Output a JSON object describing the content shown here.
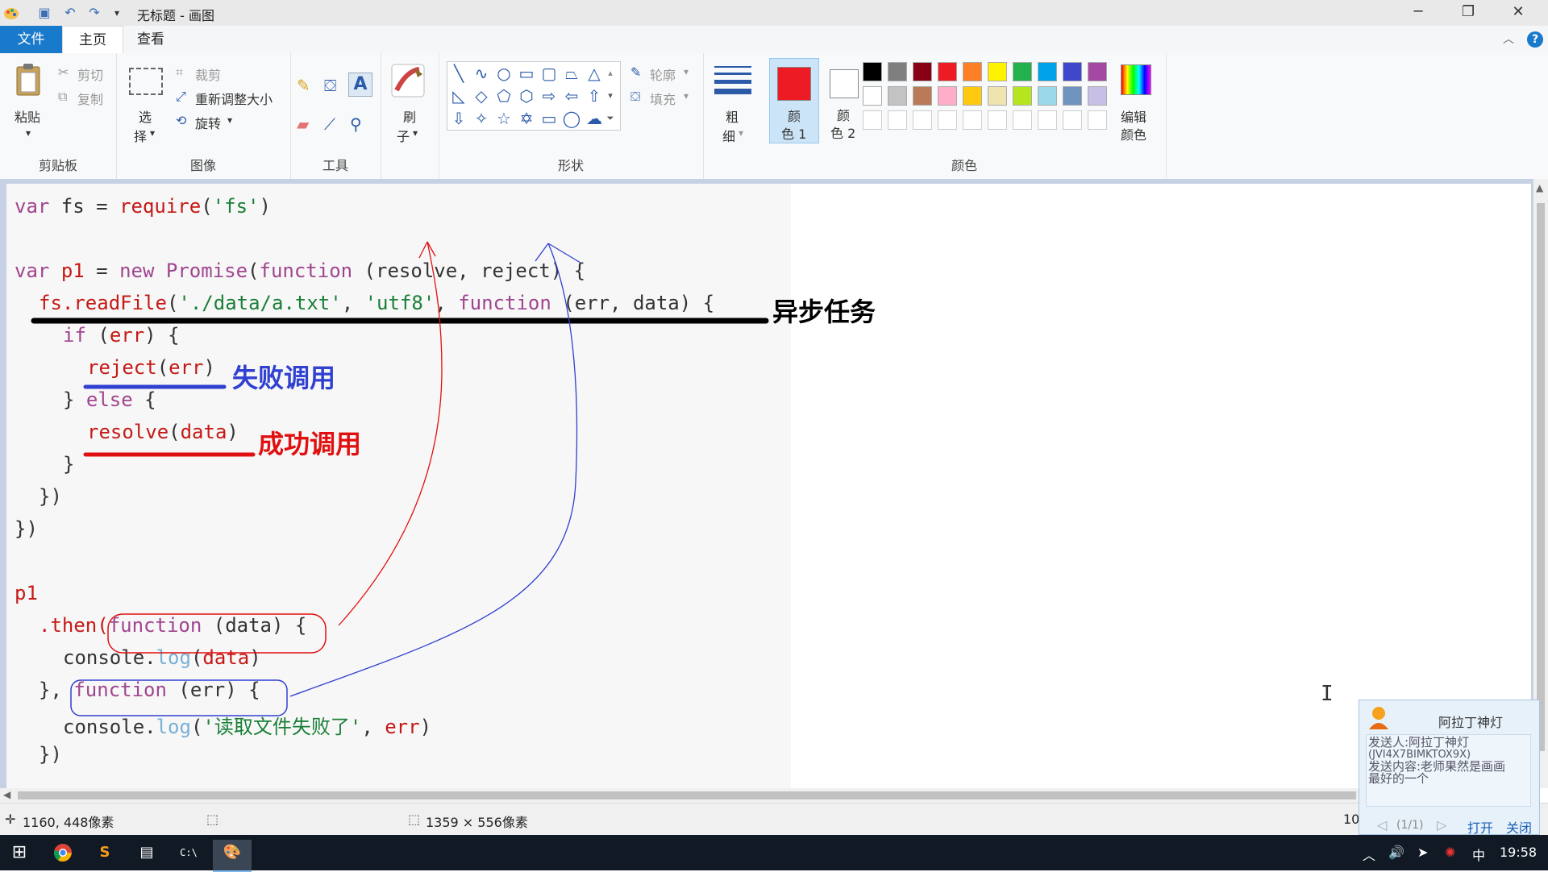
{
  "window": {
    "title": "无标题 - 画图"
  },
  "tabs": [
    "文件",
    "主页",
    "查看"
  ],
  "ribbon": {
    "clipboard": {
      "paste": "粘贴",
      "cut": "剪切",
      "copy": "复制",
      "label": "剪贴板"
    },
    "image": {
      "select_line1": "选",
      "select_line2": "择",
      "crop": "裁剪",
      "resize": "重新调整大小",
      "rotate": "旋转",
      "label": "图像"
    },
    "tools": {
      "label": "工具"
    },
    "brush": {
      "line1": "刷",
      "line2": "子"
    },
    "shapes": {
      "outline": "轮廓",
      "fill": "填充",
      "label": "形状"
    },
    "size": {
      "line1": "粗",
      "line2": "细"
    },
    "color1": {
      "line1": "颜",
      "line2": "色 1",
      "value": "#ed1c24"
    },
    "color2": {
      "line1": "颜",
      "line2": "色 2",
      "value": "#ffffff"
    },
    "colors": {
      "label": "颜色",
      "row1": [
        "#000000",
        "#7f7f7f",
        "#880015",
        "#ed1c24",
        "#ff7f27",
        "#fff200",
        "#22b14c",
        "#00a2e8",
        "#3f48cc",
        "#a349a4"
      ],
      "row2": [
        "#ffffff",
        "#c3c3c3",
        "#b97a57",
        "#ffaec9",
        "#ffc90e",
        "#efe4b0",
        "#b5e61d",
        "#99d9ea",
        "#7092be",
        "#c8bfe7"
      ]
    },
    "edit_colors": {
      "line1": "编辑",
      "line2": "颜色"
    }
  },
  "code": {
    "line1": {
      "a": "var",
      "b": " fs = ",
      "c": "require",
      "d": "(",
      "e": "'fs'",
      "f": ")"
    },
    "line3": {
      "a": "var",
      "b": " ",
      "c": "p1",
      "d": " = ",
      "e": "new",
      "f": " ",
      "g": "Promise",
      "h": "(",
      "i": "function",
      "j": " (",
      "k": "resolve",
      "l": ", ",
      "m": "reject",
      "n": ") {"
    },
    "line4": {
      "a": "fs.readFile",
      "b": "(",
      "c": "'./data/a.txt'",
      "d": ", ",
      "e": "'utf8'",
      "f": ", ",
      "g": "function",
      "h": " (err, data) {"
    },
    "line5": {
      "a": "if",
      "b": " (",
      "c": "err",
      "d": ") {"
    },
    "line6": {
      "a": "reject",
      "b": "(",
      "c": "err",
      "d": ")"
    },
    "line7": {
      "a": "} ",
      "b": "else",
      "c": " {"
    },
    "line8": {
      "a": "resolve",
      "b": "(",
      "c": "data",
      "d": ")"
    },
    "line9": "}",
    "line10": "})",
    "line11": "})",
    "line13": "p1",
    "line14": {
      "a": ".then(",
      "b": "function",
      "c": " (",
      "d": "data",
      "e": ") {"
    },
    "line15": {
      "a": "console.",
      "b": "log",
      "c": "(",
      "d": "data",
      "e": ")"
    },
    "line16": {
      "a": "}, ",
      "b": "function",
      "c": " (",
      "d": "err",
      "e": ") {"
    },
    "line17": {
      "a": "console.",
      "b": "log",
      "c": "(",
      "d": "'读取文件失败了'",
      "e": ", ",
      "f": "err",
      "g": ")"
    },
    "line18": "})"
  },
  "annotations": {
    "async": "异步任务",
    "fail": "失败调用",
    "success": "成功调用"
  },
  "status": {
    "cursor": "1160, 448像素",
    "size": "1359 × 556像素",
    "zoom": "10"
  },
  "popup": {
    "name": "阿拉丁神灯",
    "sender": "发送人:阿拉丁神灯",
    "sender_id": "(JVI4X7BIMKTOX9X)",
    "content_1": "发送内容:老师果然是画画",
    "content_2": "最好的一个",
    "pager": "(1/1)",
    "open": "打开",
    "close": "关闭"
  },
  "taskbar": {
    "ime": "中",
    "time": "19:58"
  }
}
